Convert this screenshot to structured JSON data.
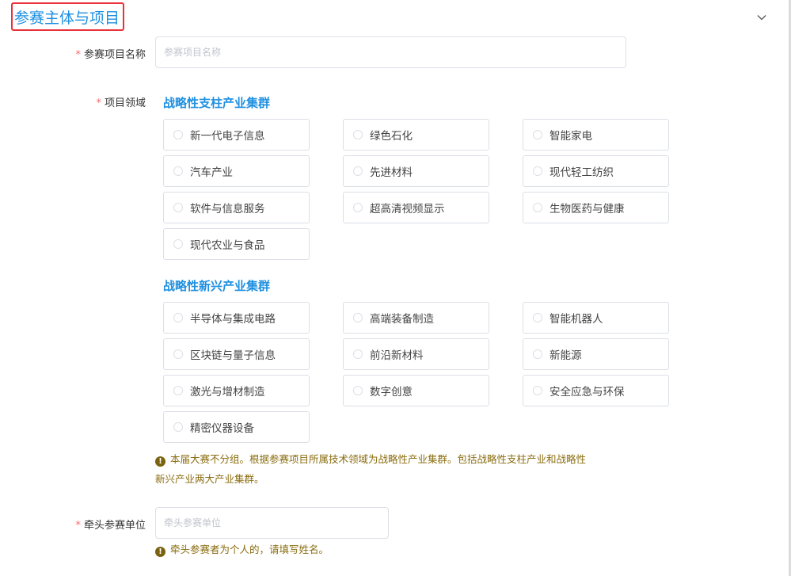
{
  "section": {
    "title": "参赛主体与项目"
  },
  "project_name": {
    "label": "参赛项目名称",
    "placeholder": "参赛项目名称",
    "required": "*"
  },
  "field": {
    "label": "项目领域",
    "required": "*",
    "groups": [
      {
        "title": "战略性支柱产业集群",
        "options": [
          "新一代电子信息",
          "绿色石化",
          "智能家电",
          "汽车产业",
          "先进材料",
          "现代轻工纺织",
          "软件与信息服务",
          "超高清视频显示",
          "生物医药与健康",
          "现代农业与食品"
        ]
      },
      {
        "title": "战略性新兴产业集群",
        "options": [
          "半导体与集成电路",
          "高端装备制造",
          "智能机器人",
          "区块链与量子信息",
          "前沿新材料",
          "新能源",
          "激光与增材制造",
          "数字创意",
          "安全应急与环保",
          "精密仪器设备"
        ]
      }
    ],
    "notice_icon": "!",
    "notice_line1": "本届大赛不分组。根据参赛项目所属技术领域为战略性产业集群。包括战略性支柱产业和战略性",
    "notice_line2": "新兴产业两大产业集群。"
  },
  "lead_unit": {
    "label": "牵头参赛单位",
    "required": "*",
    "placeholder": "牵头参赛单位",
    "notice_icon": "!",
    "notice": "牵头参赛者为个人的，请填写姓名。"
  },
  "icons": {
    "collapse": "chevron-down-icon",
    "warning": "warning-icon"
  },
  "colors": {
    "accent": "#1e90e0",
    "required": "#f56c6c",
    "notice": "#8a6d10",
    "highlight_border": "#e8313b"
  }
}
